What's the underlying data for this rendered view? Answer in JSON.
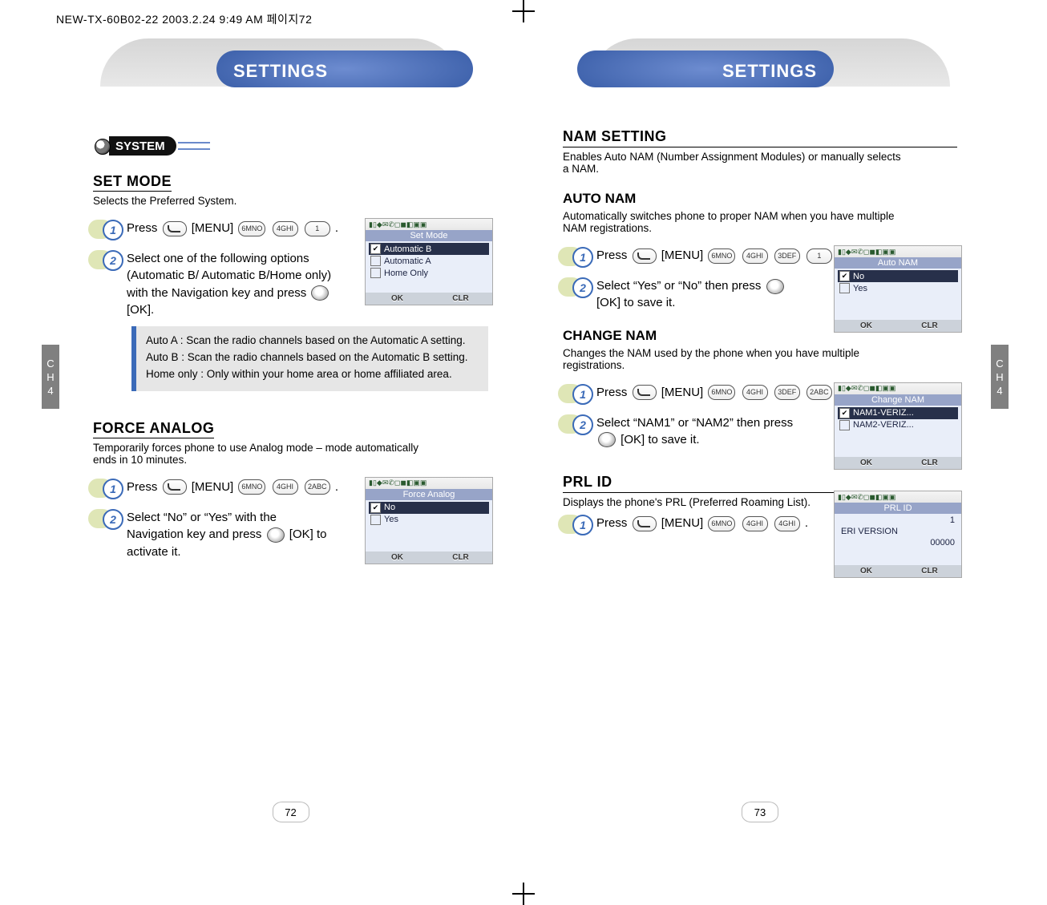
{
  "doc_header": "NEW-TX-60B02-22  2003.2.24 9:49 AM  페이지72",
  "chapter_tab": {
    "line1": "C",
    "line2": "H",
    "line3": "4"
  },
  "left": {
    "title": "SETTINGS",
    "system_label": "SYSTEM",
    "sections": {
      "set_mode": {
        "heading": "SET MODE",
        "desc": "Selects the Preferred System.",
        "step1": {
          "pre": "Press",
          "menu": "[MENU]",
          "keys": [
            "6MNO",
            "4GHI",
            "1"
          ],
          "post": "."
        },
        "step2": "Select one of the following options (Automatic B/ Automatic B/Home only) with the Navigation key and press       [OK].",
        "step2_ok": "[OK]",
        "infobox": [
          "Auto A : Scan the radio channels based on the Automatic A setting.",
          "Auto B : Scan the radio channels based on the Automatic B setting.",
          "Home only : Only within your home area or home affiliated area."
        ],
        "screen": {
          "title": "Set Mode",
          "items": [
            {
              "label": "Automatic B",
              "selected": true,
              "checked": true
            },
            {
              "label": "Automatic A",
              "selected": false,
              "checked": false
            },
            {
              "label": "Home Only",
              "selected": false,
              "checked": false
            }
          ],
          "ok": "OK",
          "clr": "CLR"
        }
      },
      "force_analog": {
        "heading": "FORCE ANALOG",
        "desc": "Temporarily forces phone to use Analog mode – mode automatically ends in 10 minutes.",
        "step1": {
          "pre": "Press",
          "menu": "[MENU]",
          "keys": [
            "6MNO",
            "4GHI",
            "2ABC"
          ],
          "post": "."
        },
        "step2": "Select “No” or “Yes” with the Navigation key and press       [OK] to activate it.",
        "screen": {
          "title": "Force Analog",
          "items": [
            {
              "label": "No",
              "selected": true,
              "checked": true
            },
            {
              "label": "Yes",
              "selected": false,
              "checked": false
            }
          ],
          "ok": "OK",
          "clr": "CLR"
        }
      }
    },
    "page_number": "72"
  },
  "right": {
    "title": "SETTINGS",
    "sections": {
      "nam_setting": {
        "heading": "NAM SETTING",
        "desc": "Enables Auto NAM (Number Assignment Modules) or manually selects a NAM."
      },
      "auto_nam": {
        "heading": "AUTO NAM",
        "desc": "Automatically switches phone to proper NAM when you have multiple NAM registrations.",
        "step1": {
          "pre": "Press",
          "menu": "[MENU]",
          "keys": [
            "6MNO",
            "4GHI",
            "3DEF",
            "1"
          ],
          "post": "."
        },
        "step2": "Select “Yes” or “No” then press        [OK] to save it.",
        "screen": {
          "title": "Auto NAM",
          "items": [
            {
              "label": "No",
              "selected": true,
              "checked": true
            },
            {
              "label": "Yes",
              "selected": false,
              "checked": false
            }
          ],
          "ok": "OK",
          "clr": "CLR"
        }
      },
      "change_nam": {
        "heading": "CHANGE NAM",
        "desc": "Changes the NAM used by the phone when you have multiple registrations.",
        "step1": {
          "pre": "Press",
          "menu": "[MENU]",
          "keys": [
            "6MNO",
            "4GHI",
            "3DEF",
            "2ABC"
          ],
          "post": "."
        },
        "step2": "Select “NAM1” or “NAM2” then press        [OK] to save it.",
        "screen": {
          "title": "Change NAM",
          "items": [
            {
              "label": "NAM1-VERIZ...",
              "selected": true,
              "checked": true
            },
            {
              "label": "NAM2-VERIZ...",
              "selected": false,
              "checked": false
            }
          ],
          "ok": "OK",
          "clr": "CLR"
        }
      },
      "prl_id": {
        "heading": "PRL ID",
        "desc": "Displays the phone's PRL (Preferred Roaming List).",
        "step1": {
          "pre": "Press",
          "menu": "[MENU]",
          "keys": [
            "6MNO",
            "4GHI",
            "4GHI"
          ],
          "post": "."
        },
        "screen": {
          "title": "PRL ID",
          "lines": [
            {
              "label": "",
              "value": "1"
            },
            {
              "label": "ERI VERSION",
              "value": ""
            },
            {
              "label": "",
              "value": "00000"
            }
          ],
          "ok": "OK",
          "clr": "CLR"
        }
      }
    },
    "page_number": "73"
  },
  "status_icons_text": "▮▯◆✉✆◻◼◧▣▣"
}
